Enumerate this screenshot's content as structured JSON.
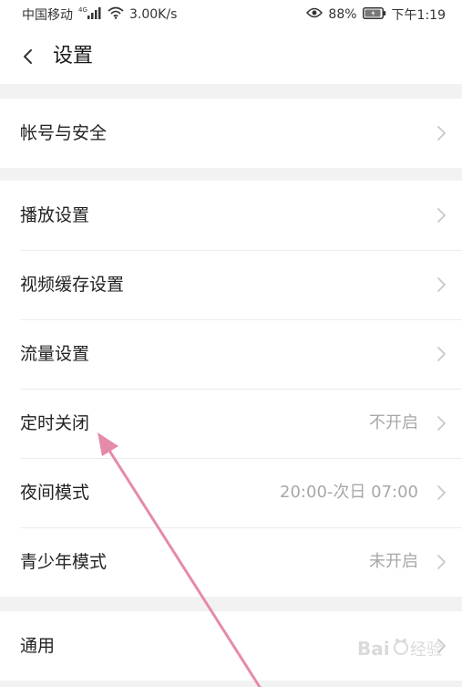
{
  "status_bar": {
    "carrier": "中国移动",
    "network_type": "4G",
    "speed": "3.00K/s",
    "battery_percent": "88%",
    "time": "下午1:19",
    "icons": [
      "signal-icon",
      "wifi-icon",
      "eye-icon",
      "battery-icon"
    ]
  },
  "header": {
    "back_icon": "chevron-left-icon",
    "title": "设置"
  },
  "groups": [
    {
      "items": [
        {
          "label": "帐号与安全",
          "value": ""
        }
      ]
    },
    {
      "items": [
        {
          "label": "播放设置",
          "value": ""
        },
        {
          "label": "视频缓存设置",
          "value": ""
        },
        {
          "label": "流量设置",
          "value": ""
        },
        {
          "label": "定时关闭",
          "value": "不开启"
        },
        {
          "label": "夜间模式",
          "value": "20:00-次日 07:00"
        },
        {
          "label": "青少年模式",
          "value": "未开启"
        }
      ]
    },
    {
      "items": [
        {
          "label": "通用",
          "value": ""
        }
      ]
    }
  ],
  "annotation": {
    "arrow_color": "#e68aa9"
  },
  "watermark": {
    "brand": "Baidu经验"
  },
  "colors": {
    "background": "#f2f2f2",
    "surface": "#ffffff",
    "text_primary": "#222222",
    "text_secondary": "#a8a8a8",
    "divider": "#ececec",
    "chevron": "#c8c8c8"
  }
}
